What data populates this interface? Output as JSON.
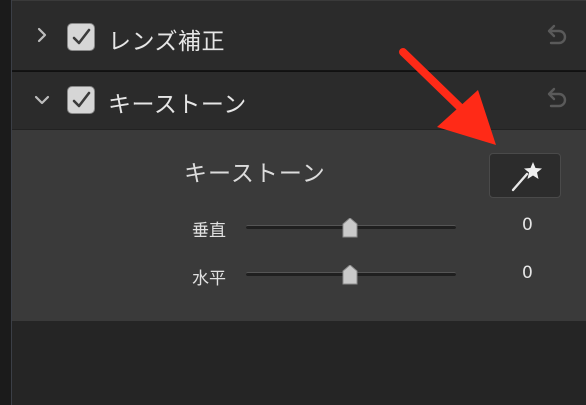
{
  "panels": {
    "lens_correction": {
      "title": "レンズ補正",
      "checked": true,
      "expanded": false
    },
    "keystone": {
      "title": "キーストーン",
      "checked": true,
      "expanded": true,
      "body": {
        "heading": "キーストーン",
        "auto_button_icon": "magic-wand-icon",
        "sliders": [
          {
            "label": "垂直",
            "value": "0",
            "level": 0.5
          },
          {
            "label": "水平",
            "value": "0",
            "level": 0.5
          }
        ]
      }
    }
  },
  "colors": {
    "annotation_arrow": "#ff2a17",
    "panel_bg": "#2b2b2b",
    "panel_body_bg": "#3a3a3a",
    "text": "#e6e6e6"
  },
  "icons": {
    "chevron_right": "chevron-right-icon",
    "chevron_down": "chevron-down-icon",
    "reset": "reset-icon",
    "check": "check-icon"
  }
}
